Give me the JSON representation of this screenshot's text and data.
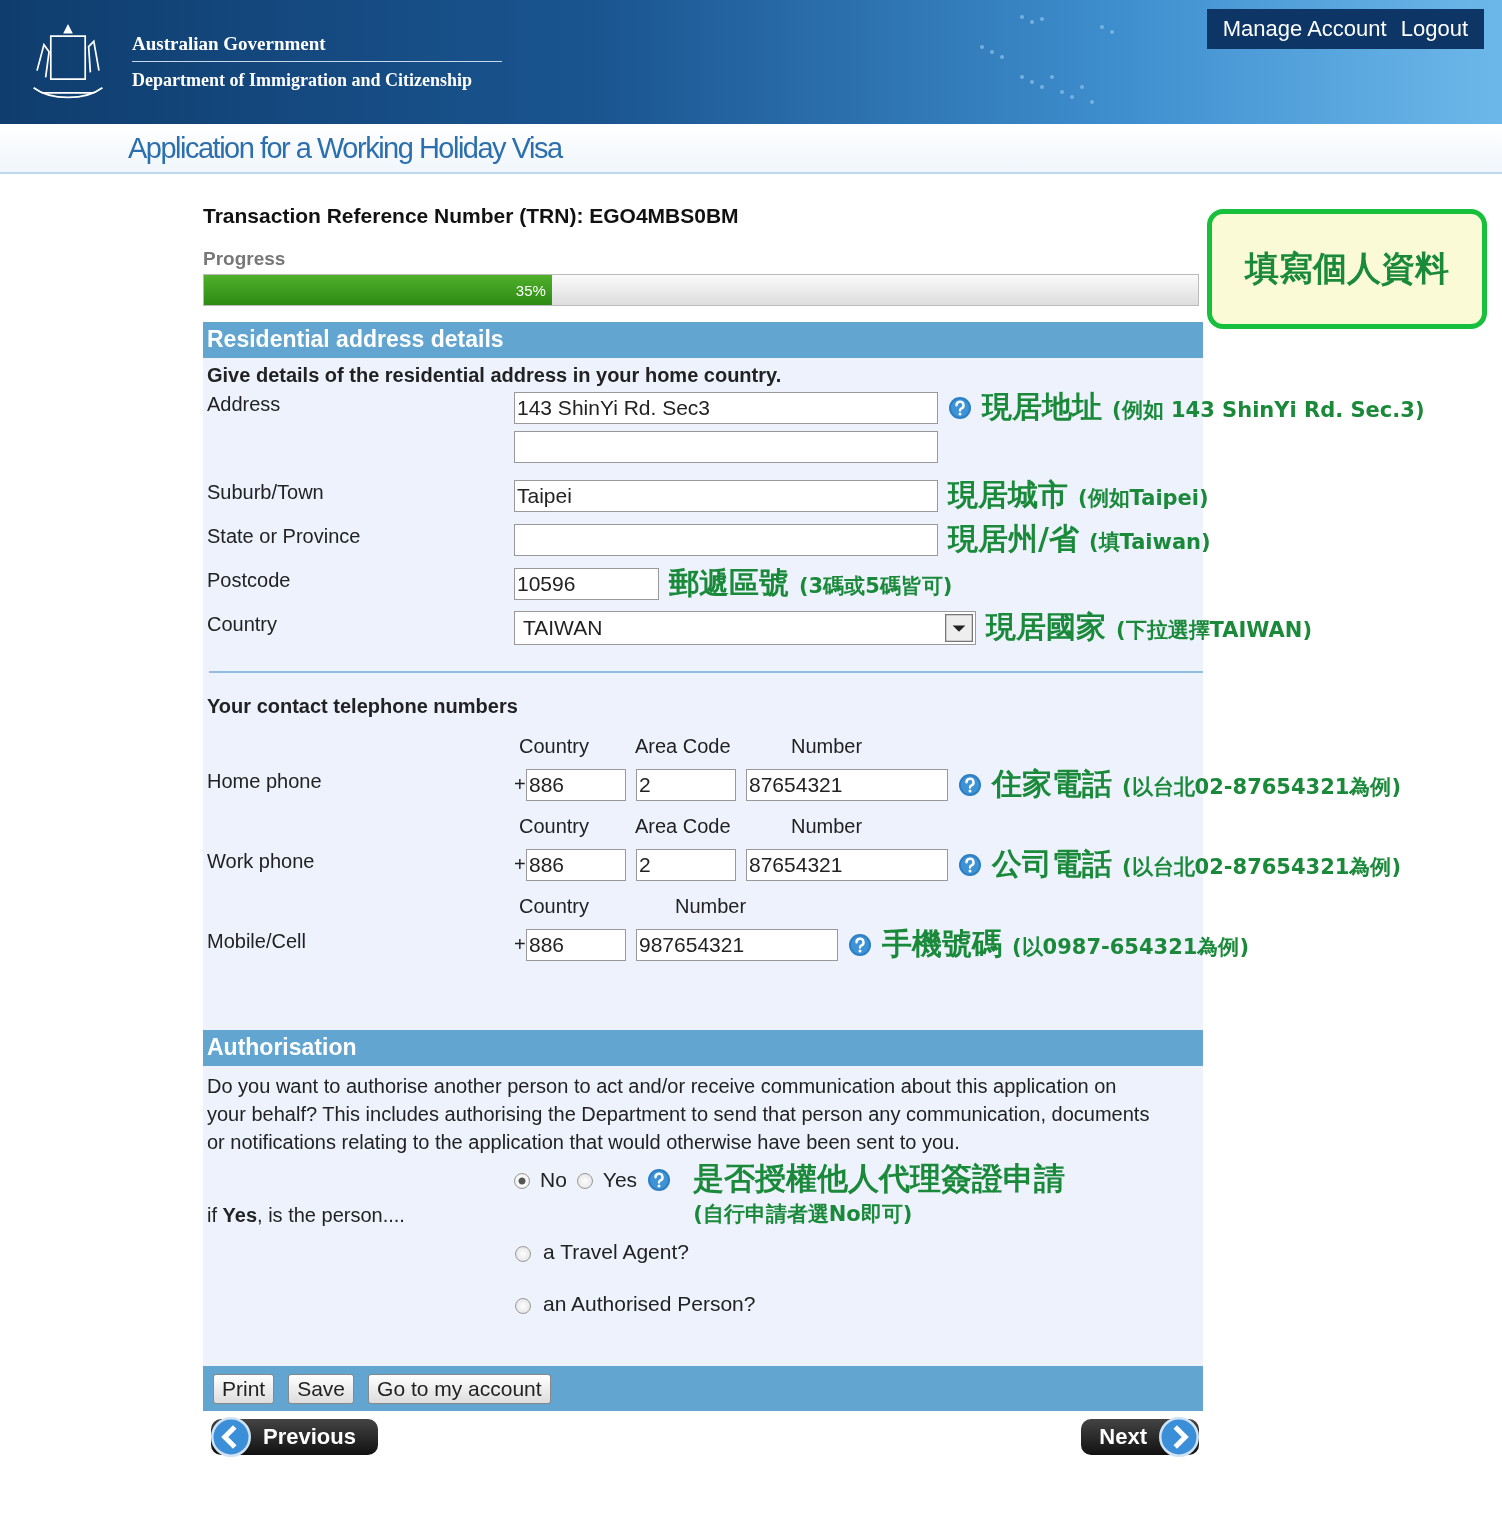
{
  "header": {
    "agency_line1": "Australian Government",
    "agency_line2": "Department of Immigration and Citizenship",
    "account_links": [
      "Manage Account",
      "Logout"
    ]
  },
  "page_title": "Application for a Working Holiday Visa",
  "trn": "Transaction Reference Number (TRN): EGO4MBS0BM",
  "progress": {
    "label": "Progress",
    "level": 0.35,
    "reading": "35%"
  },
  "callout": "填寫個人資料",
  "address_section": {
    "title": "Residential address details",
    "intro": "Give details of the residential address in your home country.",
    "fields": [
      {
        "kind": "text",
        "label": "Address",
        "value": "143 ShinYi Rd. Sec3",
        "help": true,
        "note": {
          "main": "現居地址",
          "detail": "(例如 143 ShinYi Rd. Sec.3)"
        }
      },
      {
        "kind": "text",
        "help": false
      },
      {
        "kind": "text",
        "label": "Suburb/Town",
        "value": "Taipei",
        "help": false,
        "note": {
          "main": "現居城市",
          "detail": "(例如Taipei)"
        }
      },
      {
        "kind": "text",
        "label": "State or Province",
        "help": false,
        "note": {
          "main": "現居州/省",
          "detail": "(填Taiwan)"
        }
      },
      {
        "kind": "short_text",
        "label": "Postcode",
        "value": "10596",
        "help": false,
        "note": {
          "main": "郵遞區號",
          "detail": "(3碼或5碼皆可)"
        }
      },
      {
        "kind": "select",
        "label": "Country",
        "value": "TAIWAN",
        "help": false,
        "note": {
          "main": "現居國家",
          "detail": "(下拉選擇TAIWAN)"
        }
      }
    ]
  },
  "phone_section": {
    "title": "Your contact telephone numbers",
    "rows": [
      {
        "label": "Home phone",
        "prefix": "+",
        "parts": [
          {
            "header": "Country",
            "value": "886"
          },
          {
            "header": "Area Code",
            "value": "2"
          },
          {
            "header": "Number",
            "value": "87654321"
          }
        ],
        "help": true,
        "note": {
          "main": "住家電話",
          "detail": "(以台北02-87654321為例)"
        }
      },
      {
        "label": "Work phone",
        "prefix": "+",
        "parts": [
          {
            "header": "Country",
            "value": "886"
          },
          {
            "header": "Area Code",
            "value": "2"
          },
          {
            "header": "Number",
            "value": "87654321"
          }
        ],
        "help": true,
        "note": {
          "main": "公司電話",
          "detail": "(以台北02-87654321為例)"
        }
      },
      {
        "label": "Mobile/Cell",
        "prefix": "+",
        "parts": [
          {
            "header": "Country",
            "value": "886"
          },
          {
            "header": "Number",
            "value": "987654321"
          }
        ],
        "help": true,
        "note": {
          "main": "手機號碼",
          "detail": "(以0987-654321為例)"
        }
      }
    ]
  },
  "authorisation": {
    "title": "Authorisation",
    "text": "Do you want to authorise another person to act and/or receive communication about this application on your behalf? This includes authorising the Department to send that person any communication, documents or notifications relating to the application that would otherwise have been sent to you.",
    "options": [
      {
        "label": "No",
        "selected": true
      },
      {
        "label": "Yes",
        "selected": false
      }
    ],
    "help": true,
    "note": {
      "main": "是否授權他人代理簽證申請",
      "detail": "(自行申請者選No即可)"
    },
    "followup_label": "if **Yes**, is the person....",
    "sub_options": [
      {
        "label": "a Travel Agent?",
        "selected": false
      },
      {
        "label": "an Authorised Person?",
        "selected": false
      }
    ]
  },
  "footer_buttons": [
    "Print",
    "Save",
    "Go to my account"
  ],
  "nav": {
    "previous": "Previous",
    "next": "Next"
  }
}
